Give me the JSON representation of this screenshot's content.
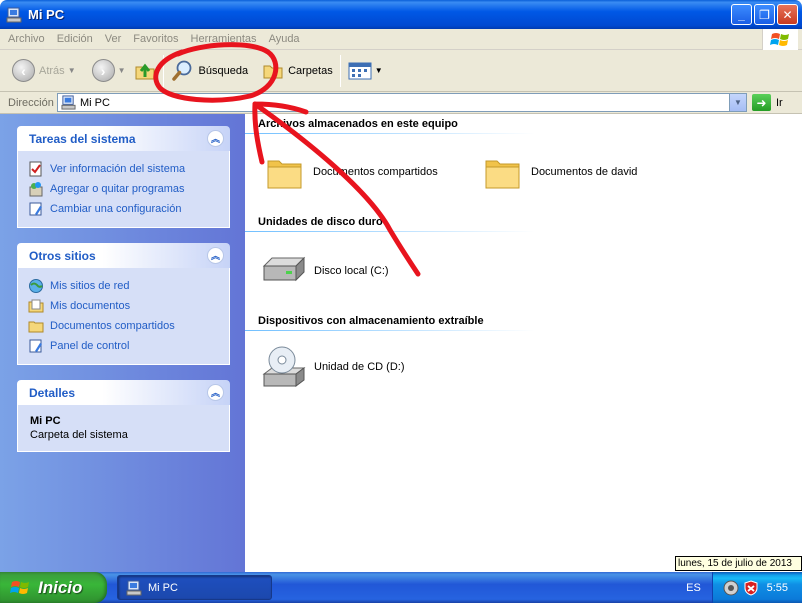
{
  "window": {
    "title": "Mi PC",
    "buttons": {
      "minimize": "_",
      "maximize": "❐",
      "close": "✕"
    }
  },
  "menu": {
    "items": [
      "Archivo",
      "Edición",
      "Ver",
      "Favoritos",
      "Herramientas",
      "Ayuda"
    ]
  },
  "toolbar": {
    "back_label": "Atrás",
    "search_label": "Búsqueda",
    "folders_label": "Carpetas"
  },
  "address": {
    "label": "Dirección",
    "value": "Mi PC",
    "go_label": "Ir"
  },
  "left_panel": {
    "system_tasks": {
      "title": "Tareas del sistema",
      "items": [
        "Ver información del sistema",
        "Agregar o quitar programas",
        "Cambiar una configuración"
      ]
    },
    "other_places": {
      "title": "Otros sitios",
      "items": [
        "Mis sitios de red",
        "Mis documentos",
        "Documentos compartidos",
        "Panel de control"
      ]
    },
    "details": {
      "title": "Detalles",
      "name": "Mi PC",
      "description": "Carpeta del sistema"
    }
  },
  "content": {
    "groups": [
      {
        "title": "Archivos almacenados en este equipo",
        "items": [
          "Documentos compartidos",
          "Documentos de david"
        ]
      },
      {
        "title": "Unidades de disco duro",
        "items": [
          "Disco local (C:)"
        ]
      },
      {
        "title": "Dispositivos con almacenamiento extraíble",
        "items": [
          "Unidad de CD (D:)"
        ]
      }
    ]
  },
  "tooltip": {
    "date": "lunes, 15 de julio de 2013"
  },
  "taskbar": {
    "start_label": "Inicio",
    "window_button": "Mi PC",
    "language": "ES",
    "time": "5:55"
  },
  "colors": {
    "titlebar": "#0058e6",
    "link": "#215dc6",
    "annotation": "#e8141e",
    "start_green": "#39b639"
  }
}
